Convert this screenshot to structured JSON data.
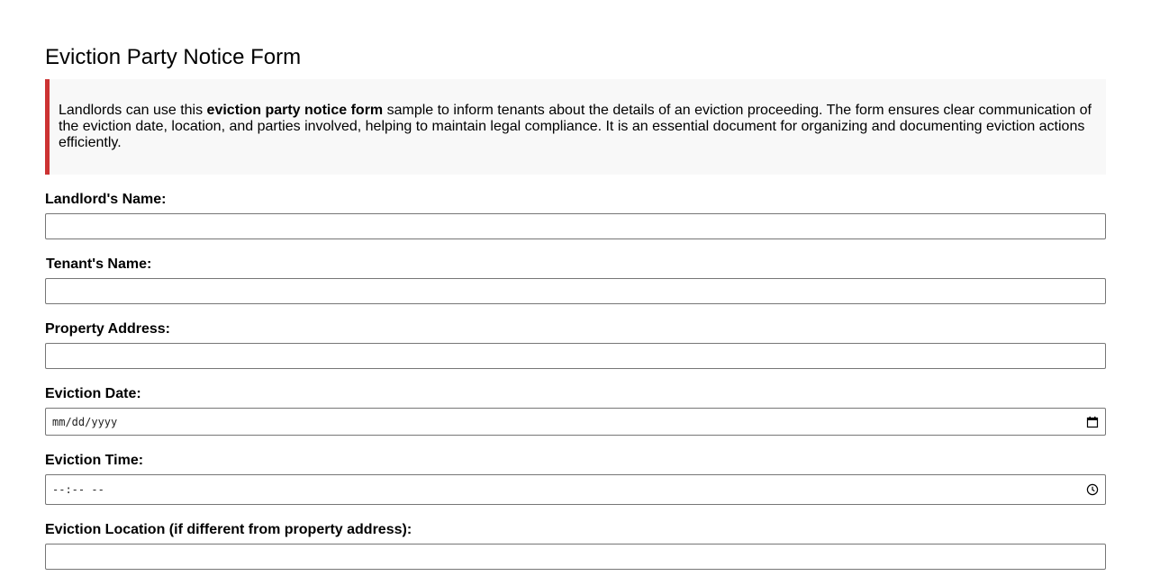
{
  "form": {
    "title": "Eviction Party Notice Form",
    "intro": {
      "prefix": "Landlords can use this ",
      "bold": "eviction party notice form",
      "suffix": " sample to inform tenants about the details of an eviction proceeding. The form ensures clear communication of the eviction date, location, and parties involved, helping to maintain legal compliance. It is an essential document for organizing and documenting eviction actions efficiently."
    },
    "accent_color": "#cc3333",
    "fields": {
      "landlord_name": {
        "label": "Landlord's Name:",
        "value": ""
      },
      "tenant_name": {
        "label": "Tenant's Name:",
        "value": ""
      },
      "property_address": {
        "label": "Property Address:",
        "value": ""
      },
      "eviction_date": {
        "label": "Eviction Date:",
        "placeholder": "mm/dd/yyyy",
        "icon": "calendar-icon"
      },
      "eviction_time": {
        "label": "Eviction Time:",
        "placeholder": "--:-- --",
        "icon": "clock-icon"
      },
      "eviction_location": {
        "label": "Eviction Location (if different from property address):",
        "value": ""
      }
    }
  }
}
